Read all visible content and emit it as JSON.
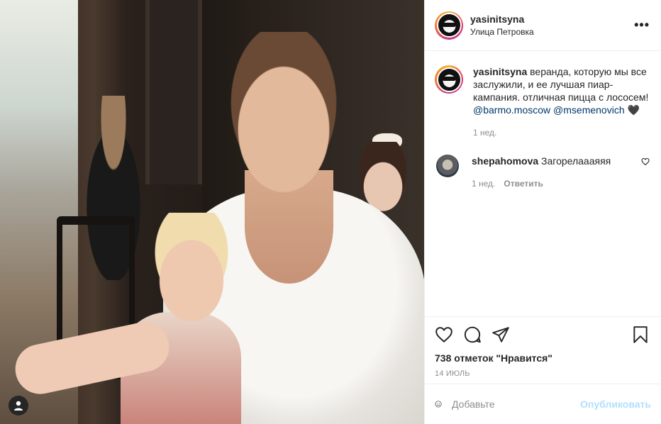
{
  "header": {
    "username": "yasinitsyna",
    "location": "Улица Петровка",
    "more_icon": "more-horizontal-icon"
  },
  "caption": {
    "username": "yasinitsyna",
    "text": " веранда, которую мы все заслужили, и ее лучшая пиар-кампания. отличная пицца с лососем! ",
    "mention1": "@barmo.moscow",
    "mention2": "@msemenovich",
    "emoji": " 🖤",
    "time": "1 нед."
  },
  "comments": [
    {
      "username": "shepahomova",
      "text": "Загорелаааяяя",
      "time": "1 нед.",
      "reply_label": "Ответить"
    }
  ],
  "actions": {
    "like_icon": "heart-icon",
    "comment_icon": "comment-icon",
    "share_icon": "paper-plane-icon",
    "save_icon": "bookmark-icon"
  },
  "likes": "738 отметок \"Нравится\"",
  "date": "14 ИЮЛЬ",
  "add_comment": {
    "placeholder": "Добавьте",
    "publish_label": "Опубликовать",
    "emoji_icon": "smiley-icon"
  },
  "colors": {
    "accent_link": "#00376b",
    "publish_disabled": "#b2dffc",
    "muted": "#8e8e8e"
  }
}
